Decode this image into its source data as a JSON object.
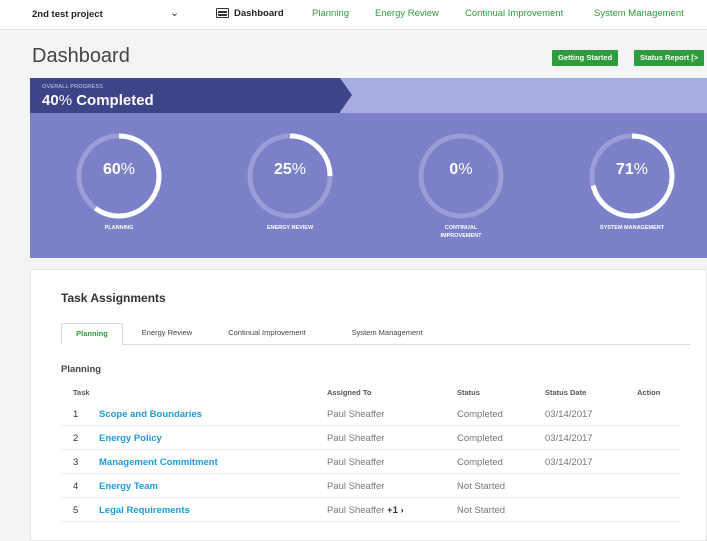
{
  "nav": {
    "project": "2nd test project",
    "items": [
      {
        "label": "Dashboard",
        "active": true
      },
      {
        "label": "Planning",
        "active": false
      },
      {
        "label": "Energy Review",
        "active": false
      },
      {
        "label": "Continual Improvement",
        "active": false
      },
      {
        "label": "System Management",
        "active": false
      }
    ]
  },
  "header": {
    "title": "Dashboard",
    "getting_started": "Getting Started",
    "status_report": "Status Report [>"
  },
  "progress": {
    "overall_label": "OVERALL PROGRESS",
    "overall_value": "40",
    "overall_suffix": "% Completed",
    "overall_fraction": 0.4,
    "colors": {
      "panel": "#7b80c8",
      "dark": "#3d4488",
      "strip": "#a7abdf"
    },
    "gauges": [
      {
        "value": "60",
        "fraction": 0.6,
        "label": "PLANNING"
      },
      {
        "value": "25",
        "fraction": 0.25,
        "label": "ENERGY REVIEW"
      },
      {
        "value": "0",
        "fraction": 0.0,
        "label": "CONTINUAL\nIMPROVEMENT"
      },
      {
        "value": "71",
        "fraction": 0.71,
        "label": "SYSTEM MANAGEMENT"
      }
    ],
    "pct_sign": "%"
  },
  "tasks": {
    "title": "Task Assignments",
    "tabs": [
      "Planning",
      "Energy Review",
      "Continual Improvement",
      "System Management"
    ],
    "active_tab": 0,
    "section": "Planning",
    "columns": [
      "Task",
      "Assigned To",
      "Status",
      "Status Date",
      "Action"
    ],
    "rows": [
      {
        "num": "1",
        "task": "Scope and Boundaries",
        "assigned": "Paul Sheaffer",
        "extra": "",
        "status": "Completed",
        "date": "03/14/2017"
      },
      {
        "num": "2",
        "task": "Energy Policy",
        "assigned": "Paul Sheaffer",
        "extra": "",
        "status": "Completed",
        "date": "03/14/2017"
      },
      {
        "num": "3",
        "task": "Management Commitment",
        "assigned": "Paul Sheaffer",
        "extra": "",
        "status": "Completed",
        "date": "03/14/2017"
      },
      {
        "num": "4",
        "task": "Energy Team",
        "assigned": "Paul Sheaffer",
        "extra": "",
        "status": "Not Started",
        "date": ""
      },
      {
        "num": "5",
        "task": "Legal Requirements",
        "assigned": "Paul Sheaffer",
        "extra": "+1 ›",
        "status": "Not Started",
        "date": ""
      }
    ]
  },
  "accent": "#2e9b3c",
  "link_color": "#1f9bd7"
}
